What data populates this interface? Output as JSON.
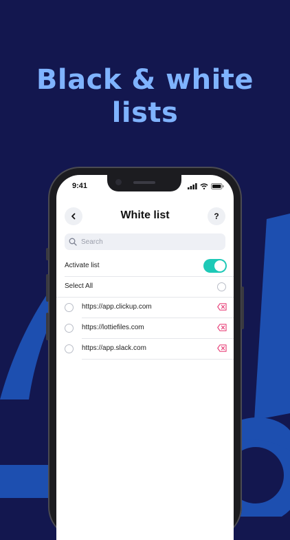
{
  "headline": {
    "line1": "Black & white",
    "line2": "lists"
  },
  "status_bar": {
    "time": "9:41"
  },
  "nav": {
    "title": "White list",
    "back_icon": "chevron-left-icon",
    "help_label": "?"
  },
  "search": {
    "placeholder": "Search",
    "value": ""
  },
  "activate": {
    "label": "Activate list",
    "enabled": true
  },
  "select_all": {
    "label": "Select All",
    "checked": false
  },
  "sites": [
    {
      "url": "https://app.clickup.com",
      "selected": false
    },
    {
      "url": "https://lottiefiles.com",
      "selected": false
    },
    {
      "url": "https://app.slack.com",
      "selected": false
    }
  ],
  "colors": {
    "background": "#13174f",
    "headline": "#7fb3ff",
    "toggle_on": "#1ec9b7",
    "delete_icon": "#e8467c",
    "deco_shape": "#1d4fb0"
  }
}
